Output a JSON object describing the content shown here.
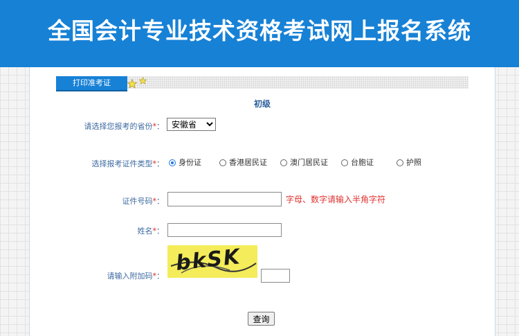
{
  "header": {
    "title": "全国会计专业技术资格考试网上报名系统"
  },
  "tab": {
    "label": "打印准考证"
  },
  "level": "初级",
  "form": {
    "province_label": "请选择您报考的省份",
    "province_value": "安徽省",
    "idtype_label": "选择报考证件类型",
    "idtype_options": [
      "身份证",
      "香港居民证",
      "澳门居民证",
      "台胞证",
      "护照"
    ],
    "idtype_selected": "身份证",
    "idnum_label": "证件号码",
    "idnum_hint": "字母、数字请输入半角字符",
    "name_label": "姓名",
    "captcha_label": "请输入附加码",
    "captcha_text": "bkSK",
    "required_mark": "*",
    "colon": "："
  },
  "buttons": {
    "query": "查询"
  },
  "colors": {
    "header_bg": "#1781d6",
    "required": "#e03030",
    "label": "#3e6aa0"
  }
}
